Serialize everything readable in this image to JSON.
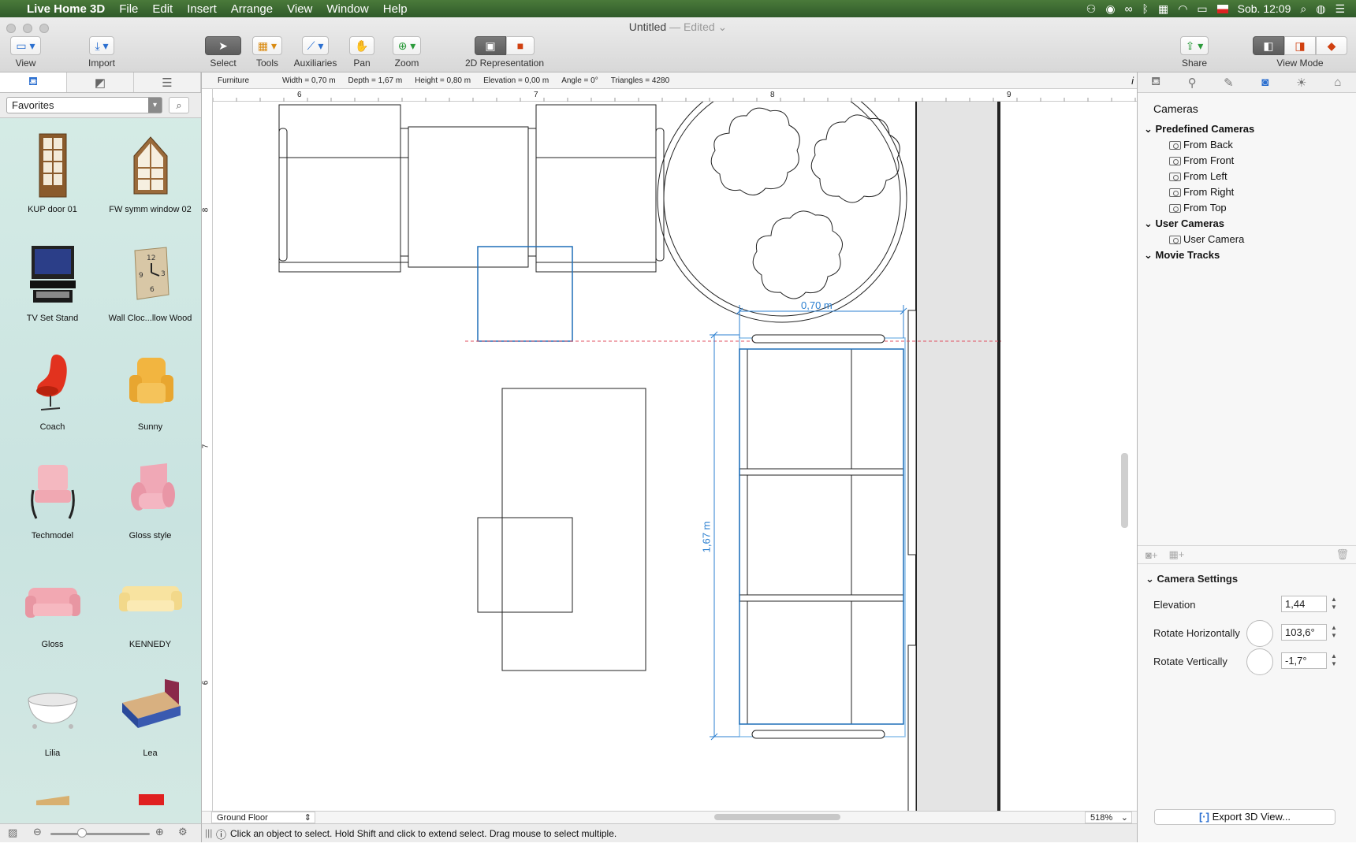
{
  "menubar": {
    "app_name": "Live Home 3D",
    "items": [
      "File",
      "Edit",
      "Insert",
      "Arrange",
      "View",
      "Window",
      "Help"
    ],
    "clock": "Sob. 12:09"
  },
  "window": {
    "title": "Untitled",
    "title_suffix": "— Edited"
  },
  "toolbar": {
    "view": "View",
    "import": "Import",
    "select": "Select",
    "tools": "Tools",
    "auxiliaries": "Auxiliaries",
    "pan": "Pan",
    "zoom": "Zoom",
    "representation": "2D Representation",
    "share": "Share",
    "view_mode": "View Mode"
  },
  "library": {
    "category": "Favorites",
    "items": [
      {
        "label": "KUP door 01",
        "icon": "door-icon"
      },
      {
        "label": "FW symm window 02",
        "icon": "window-icon"
      },
      {
        "label": "TV Set Stand",
        "icon": "tv-stand-icon"
      },
      {
        "label": "Wall Cloc...llow Wood",
        "icon": "clock-icon"
      },
      {
        "label": "Coach",
        "icon": "egg-chair-icon"
      },
      {
        "label": "Sunny",
        "icon": "armchair-icon"
      },
      {
        "label": "Techmodel",
        "icon": "chair-icon"
      },
      {
        "label": "Gloss style",
        "icon": "armchair-icon"
      },
      {
        "label": "Gloss",
        "icon": "sofa-icon"
      },
      {
        "label": "KENNEDY",
        "icon": "sofa-icon"
      },
      {
        "label": "Lilia",
        "icon": "bathtub-icon"
      },
      {
        "label": "Lea",
        "icon": "bed-icon"
      }
    ]
  },
  "infobar": {
    "type": "Furniture",
    "width": "Width = 0,70 m",
    "depth": "Depth = 1,67 m",
    "height": "Height = 0,80 m",
    "elevation": "Elevation = 0,00 m",
    "angle": "Angle = 0°",
    "triangles": "Triangles = 4280"
  },
  "ruler": {
    "unit": "m",
    "top_ticks": [
      "6",
      "7",
      "8",
      "9"
    ],
    "left_ticks": [
      "8",
      "7",
      "6"
    ]
  },
  "plan": {
    "dim_width": "0,70 m",
    "dim_depth": "1,67 m"
  },
  "canvas_footer": {
    "floor": "Ground Floor",
    "zoom": "518%"
  },
  "status": {
    "hint": "Click an object to select. Hold Shift and click to extend select. Drag mouse to select multiple."
  },
  "cameras": {
    "title": "Cameras",
    "groups": [
      {
        "label": "Predefined Cameras",
        "items": [
          "From Back",
          "From Front",
          "From Left",
          "From Right",
          "From Top"
        ]
      },
      {
        "label": "User Cameras",
        "items": [
          "User Camera"
        ]
      },
      {
        "label": "Movie Tracks",
        "items": []
      }
    ],
    "settings_title": "Camera Settings",
    "elevation_label": "Elevation",
    "elevation": "1,44",
    "rot_h_label": "Rotate Horizontally",
    "rot_h": "103,6°",
    "rot_v_label": "Rotate Vertically",
    "rot_v": "-1,7°",
    "export": "Export 3D View..."
  },
  "colors": {
    "accent": "#2b6fd0",
    "selection": "#1f78c8"
  }
}
